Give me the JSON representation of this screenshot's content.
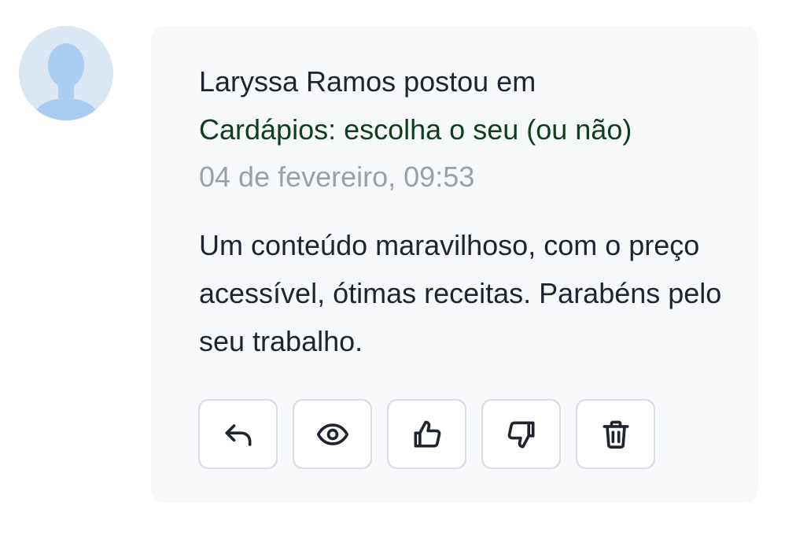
{
  "comment": {
    "author": "Laryssa Ramos",
    "action_text": "postou em",
    "author_line": "Laryssa Ramos postou em",
    "topic_title": "Cardápios: escolha o seu (ou não)",
    "timestamp": "04 de fevereiro, 09:53",
    "body": "Um conteúdo maravilhoso, com o preço acessível, ótimas receitas. Parabéns pelo seu trabalho."
  },
  "avatar": {
    "icon": "user-silhouette-icon",
    "background_color": "#dbe7f3",
    "figure_color": "#a9cdf0"
  },
  "actions": [
    {
      "name": "reply-button",
      "icon": "reply-arrow-icon"
    },
    {
      "name": "view-button",
      "icon": "eye-icon"
    },
    {
      "name": "like-button",
      "icon": "thumbs-up-icon"
    },
    {
      "name": "dislike-button",
      "icon": "thumbs-down-icon"
    },
    {
      "name": "delete-button",
      "icon": "trash-icon"
    }
  ],
  "colors": {
    "card_background": "#f7f8fa",
    "text_primary": "#1f2430",
    "link": "#0f3d22",
    "timestamp": "#9aa0aa",
    "button_border": "#d7dbe2"
  }
}
